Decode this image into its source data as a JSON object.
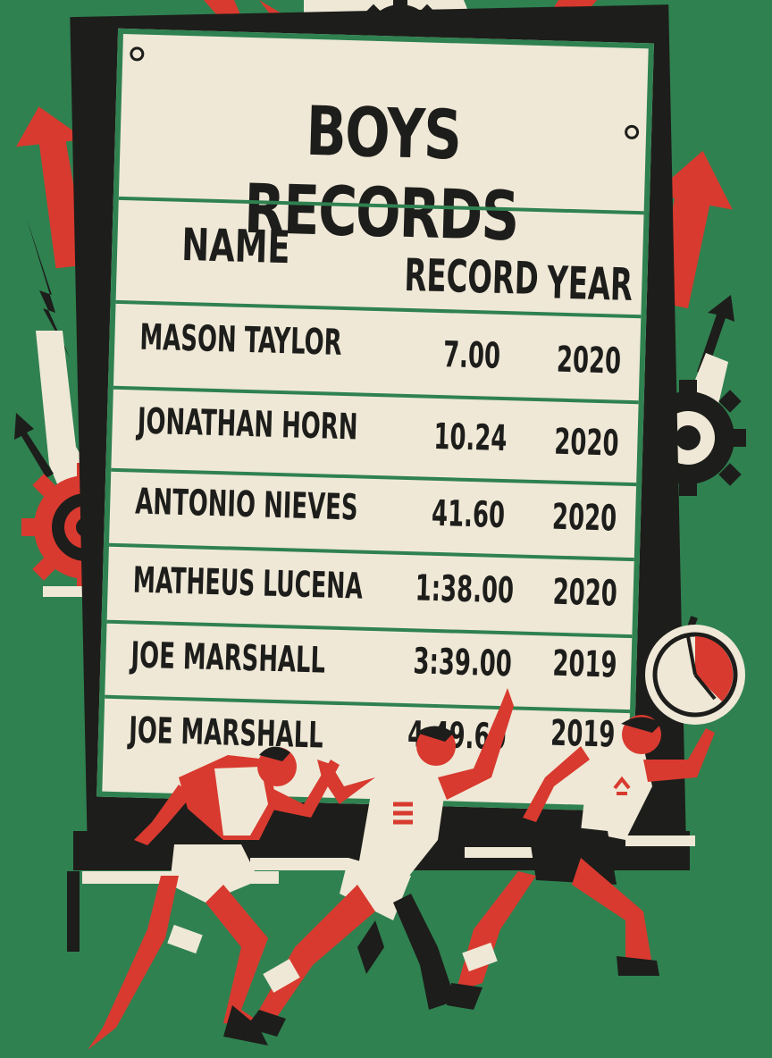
{
  "title": "BOYS RECORDS",
  "columns": [
    "NAME",
    "RECORD",
    "YEAR"
  ],
  "rows": [
    {
      "name": "MASON TAYLOR",
      "record": "7.00",
      "year": "2020"
    },
    {
      "name": "JONATHAN HORN",
      "record": "10.24",
      "year": "2020"
    },
    {
      "name": "ANTONIO NIEVES",
      "record": "41.60",
      "year": "2020"
    },
    {
      "name": "MATHEUS LUCENA",
      "record": "1:38.00",
      "year": "2020"
    },
    {
      "name": "JOE MARSHALL",
      "record": "3:39.00",
      "year": "2019"
    },
    {
      "name": "JOE MARSHALL",
      "record": "4:49.60",
      "year": "2019"
    }
  ],
  "colors": {
    "background": "#2f8150",
    "board": "#efe8d6",
    "ink": "#1d1d1b",
    "accent_red": "#d83a2f",
    "cream": "#efe8d6"
  },
  "icons": [
    "gear-icon",
    "arrow-up-icon",
    "lightning-bolt-icon",
    "stopwatch-icon"
  ],
  "figures": [
    "runner-left",
    "runner-middle",
    "runner-right"
  ]
}
